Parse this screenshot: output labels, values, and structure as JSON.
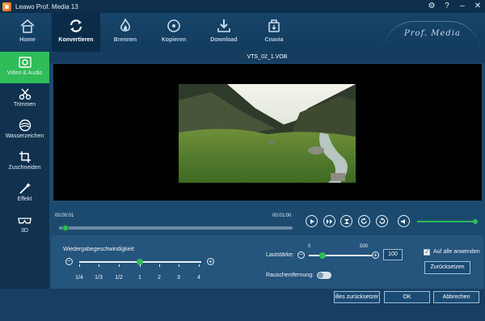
{
  "window": {
    "title": "Leawo Prof. Media 13",
    "controls": [
      "gear-icon",
      "help-icon",
      "minimize-icon",
      "close-icon"
    ]
  },
  "nav": {
    "items": [
      {
        "label": "Home",
        "icon": "home-icon"
      },
      {
        "label": "Konvertieren",
        "icon": "convert-icon",
        "active": true
      },
      {
        "label": "Brennen",
        "icon": "burn-icon"
      },
      {
        "label": "Kopieren",
        "icon": "disc-copy-icon"
      },
      {
        "label": "Download",
        "icon": "download-icon"
      },
      {
        "label": "Cnavia",
        "icon": "cnavia-icon"
      }
    ],
    "brand": "Prof. Media"
  },
  "sidebar": {
    "items": [
      {
        "label": "Video & Audio",
        "icon": "video-audio-icon",
        "active": true
      },
      {
        "label": "Trimmen",
        "icon": "trim-icon"
      },
      {
        "label": "Wasserzeichen",
        "icon": "watermark-icon"
      },
      {
        "label": "Zuschneiden",
        "icon": "crop-icon"
      },
      {
        "label": "Effekt",
        "icon": "effect-icon"
      },
      {
        "label": "3D",
        "icon": "3d-glasses-icon"
      }
    ]
  },
  "preview": {
    "file_name": "VTS_02_1.VOB"
  },
  "playback": {
    "current_time": "00:00:01",
    "end_time": "00:01:00",
    "progress_fraction": 0.02,
    "volume_fraction": 1.0,
    "controls": [
      "play-icon",
      "step-icon",
      "split-icon",
      "rotate-right-icon",
      "rotate-left-icon",
      "volume-icon"
    ]
  },
  "settings": {
    "speed_label": "Wiedergabegeschwindigkeit:",
    "speed_ticks": [
      "1/4",
      "1/3",
      "1/2",
      "1",
      "2",
      "3",
      "4"
    ],
    "speed_selected": "1",
    "volume_label": "Lautstärke:",
    "volume_min": "0",
    "volume_max": "500",
    "volume_value": "100",
    "noise_label": "Rauschentfernung:",
    "noise_enabled": false,
    "apply_all_label": "Auf alle anwenden",
    "apply_all_checked": true,
    "reset_label": "Zurücksetzen"
  },
  "footer": {
    "reset_all_label": "illes zurücksetzer",
    "ok_label": "OK",
    "cancel_label": "Abbrechen"
  }
}
